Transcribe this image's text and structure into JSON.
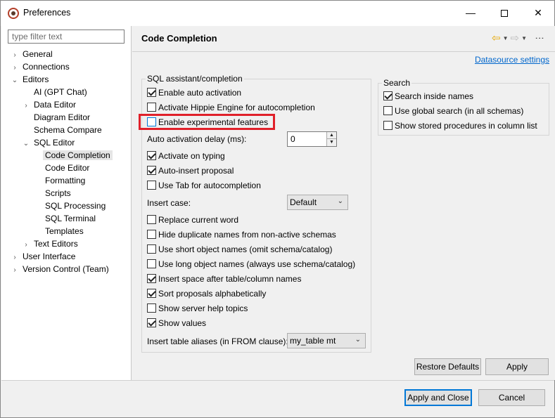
{
  "window": {
    "title": "Preferences"
  },
  "filter": {
    "placeholder": "type filter text"
  },
  "tree": [
    {
      "label": "General",
      "twisty": ">"
    },
    {
      "label": "Connections",
      "twisty": ">"
    },
    {
      "label": "Editors",
      "twisty": "v"
    },
    {
      "label": "AI (GPT Chat)",
      "twisty": ""
    },
    {
      "label": "Data Editor",
      "twisty": ">"
    },
    {
      "label": "Diagram Editor",
      "twisty": ""
    },
    {
      "label": "Schema Compare",
      "twisty": ""
    },
    {
      "label": "SQL Editor",
      "twisty": "v"
    },
    {
      "label": "Code Completion",
      "twisty": "",
      "selected": true
    },
    {
      "label": "Code Editor",
      "twisty": ""
    },
    {
      "label": "Formatting",
      "twisty": ""
    },
    {
      "label": "Scripts",
      "twisty": ""
    },
    {
      "label": "SQL Processing",
      "twisty": ""
    },
    {
      "label": "SQL Terminal",
      "twisty": ""
    },
    {
      "label": "Templates",
      "twisty": ""
    },
    {
      "label": "Text Editors",
      "twisty": ">"
    },
    {
      "label": "User Interface",
      "twisty": ">"
    },
    {
      "label": "Version Control (Team)",
      "twisty": ">"
    }
  ],
  "page": {
    "title": "Code Completion",
    "datasource_link": "Datasource settings"
  },
  "sql_group": {
    "legend": "SQL assistant/completion",
    "enable_auto_activation": {
      "label": "Enable auto activation",
      "checked": true
    },
    "hippie": {
      "label": "Activate Hippie Engine for autocompletion",
      "checked": false
    },
    "experimental": {
      "label": "Enable experimental features",
      "checked": false
    },
    "delay_label": "Auto activation delay (ms):",
    "delay_value": "0",
    "activate_on_typing": {
      "label": "Activate on typing",
      "checked": true
    },
    "auto_insert": {
      "label": "Auto-insert proposal",
      "checked": true
    },
    "use_tab": {
      "label": "Use Tab for autocompletion",
      "checked": false
    },
    "insert_case_label": "Insert case:",
    "insert_case_value": "Default",
    "replace_word": {
      "label": "Replace current word",
      "checked": false
    },
    "hide_duplicates": {
      "label": "Hide duplicate names from non-active schemas",
      "checked": false
    },
    "short_names": {
      "label": "Use short object names (omit schema/catalog)",
      "checked": false
    },
    "long_names": {
      "label": "Use long object names (always use schema/catalog)",
      "checked": false
    },
    "insert_space": {
      "label": "Insert space after table/column names",
      "checked": true
    },
    "sort_alpha": {
      "label": "Sort proposals alphabetically",
      "checked": true
    },
    "server_help": {
      "label": "Show server help topics",
      "checked": false
    },
    "show_values": {
      "label": "Show values",
      "checked": true
    },
    "alias_label": "Insert table aliases (in FROM clause):",
    "alias_value": "my_table mt"
  },
  "search_group": {
    "legend": "Search",
    "inside_names": {
      "label": "Search inside names",
      "checked": true
    },
    "global_search": {
      "label": "Use global search (in all schemas)",
      "checked": false
    },
    "stored_procs": {
      "label": "Show stored procedures in column list",
      "checked": false
    }
  },
  "buttons": {
    "restore_defaults": "Restore Defaults",
    "apply": "Apply",
    "apply_and_close": "Apply and Close",
    "cancel": "Cancel"
  }
}
